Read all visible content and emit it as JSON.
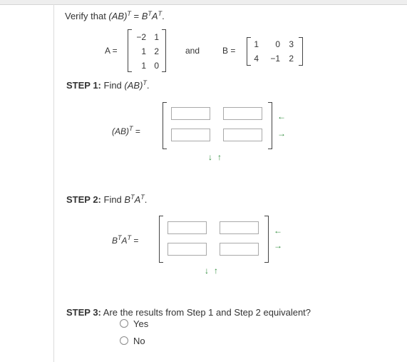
{
  "header": {
    "verify_prefix": "Verify that ",
    "eq_lhs": "(AB)",
    "eq_sup_T1": "T",
    "eq_equals": " = ",
    "eq_B": "B",
    "eq_sup_T2": "T",
    "eq_A": "A",
    "eq_sup_T3": "T",
    "eq_end": "."
  },
  "given": {
    "A_label": "A =",
    "A_rows": [
      [
        "−2",
        "1"
      ],
      [
        "1",
        "2"
      ],
      [
        "1",
        "0"
      ]
    ],
    "and_label": "and",
    "B_label": "B =",
    "B_rows": [
      [
        "1",
        "0",
        "3"
      ],
      [
        "4",
        "−1",
        "2"
      ]
    ]
  },
  "step1": {
    "label": "STEP 1:",
    "text": " Find ",
    "expr": "(AB)",
    "sup": "T",
    "end": ".",
    "lhs": "(AB)",
    "lhs_sup": "T",
    "lhs_eq": " =",
    "inputs": [
      [
        "",
        ""
      ],
      [
        "",
        ""
      ]
    ]
  },
  "step2": {
    "label": "STEP 2:",
    "text": " Find ",
    "B": "B",
    "sup1": "T",
    "A": "A",
    "sup2": "T",
    "end": ".",
    "lhs_B": "B",
    "lhs_sup1": "T",
    "lhs_A": "A",
    "lhs_sup2": "T",
    "lhs_eq": " =",
    "inputs": [
      [
        "",
        ""
      ],
      [
        "",
        ""
      ]
    ]
  },
  "step3": {
    "label": "STEP 3:",
    "question": " Are the results from Step 1 and Step 2 equivalent?",
    "options": [
      "Yes",
      "No"
    ]
  },
  "icons": {
    "col_remove": "arrow-left-icon",
    "col_add": "arrow-right-icon",
    "row_remove": "arrow-down-icon",
    "row_add": "arrow-up-icon"
  },
  "colors": {
    "arrow": "#2e8b3a"
  }
}
